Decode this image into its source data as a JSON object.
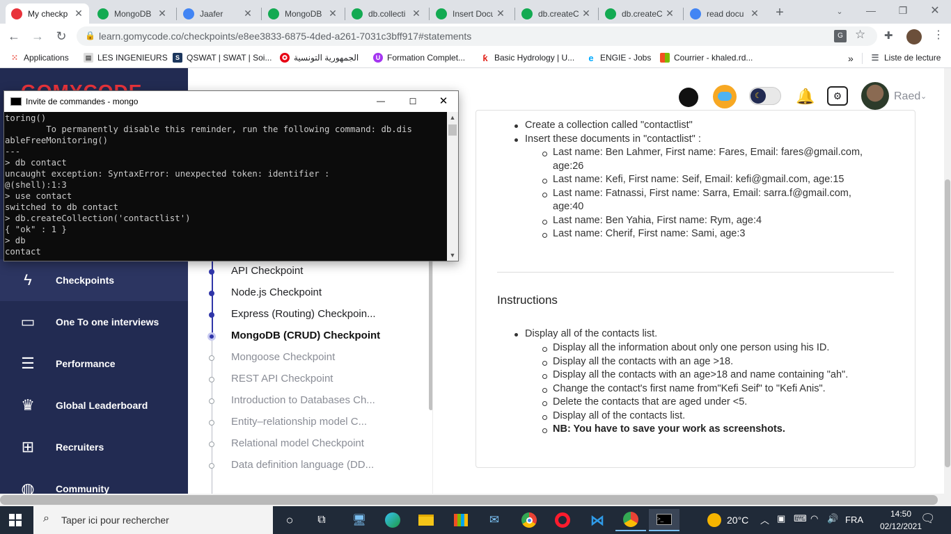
{
  "browser": {
    "tabs": [
      {
        "title": "My checkp",
        "active": true,
        "icon": "gomycode-icon",
        "color": "#e8333b"
      },
      {
        "title": "MongoDB",
        "icon": "mongodb-leaf-icon",
        "color": "#13aa52"
      },
      {
        "title": "Jaafer",
        "icon": "google-meet-icon",
        "color": "#4285f4"
      },
      {
        "title": "MongoDB",
        "icon": "mongodb-leaf-icon",
        "color": "#13aa52"
      },
      {
        "title": "db.collecti",
        "icon": "mongodb-leaf-icon",
        "color": "#13aa52"
      },
      {
        "title": "Insert Docu",
        "icon": "mongodb-leaf-icon",
        "color": "#13aa52"
      },
      {
        "title": "db.createC",
        "icon": "mongodb-leaf-icon",
        "color": "#13aa52"
      },
      {
        "title": "db.createC",
        "icon": "mongodb-leaf-icon",
        "color": "#13aa52"
      },
      {
        "title": "read docu",
        "icon": "google-icon",
        "color": "#4285f4"
      }
    ],
    "url": "learn.gomycode.co/checkpoints/e8ee3833-6875-4ded-a261-7031c3bff917#statements",
    "bookmarks": [
      {
        "label": "Applications"
      },
      {
        "label": "LES INGENIEURS"
      },
      {
        "label": "QSWAT | SWAT | Soi..."
      },
      {
        "label": "الجمهورية التونسية"
      },
      {
        "label": "Formation Complet..."
      },
      {
        "label": "Basic Hydrology | U..."
      },
      {
        "label": "ENGIE - Jobs"
      },
      {
        "label": "Courrier - khaled.rd..."
      }
    ],
    "reading_list": "Liste de lecture"
  },
  "header": {
    "user_name": "Raed"
  },
  "sidebar": {
    "items": [
      {
        "label": "Checkpoints",
        "icon": "lightning-icon",
        "active": true
      },
      {
        "label": "One To one interviews",
        "icon": "chat-icon"
      },
      {
        "label": "Performance",
        "icon": "document-lines-icon"
      },
      {
        "label": "Global Leaderboard",
        "icon": "trophy-icon"
      },
      {
        "label": "Recruiters",
        "icon": "org-chart-icon"
      },
      {
        "label": "Community",
        "icon": "globe-icon"
      }
    ]
  },
  "checkpoints": [
    {
      "label": "API Checkpoint",
      "state": "done"
    },
    {
      "label": "Node.js Checkpoint",
      "state": "done"
    },
    {
      "label": "Express (Routing) Checkpoin...",
      "state": "done"
    },
    {
      "label": "MongoDB (CRUD) Checkpoint",
      "state": "current"
    },
    {
      "label": "Mongoose Checkpoint",
      "state": "todo"
    },
    {
      "label": "REST API Checkpoint",
      "state": "todo"
    },
    {
      "label": "Introduction to Databases Ch...",
      "state": "todo"
    },
    {
      "label": "Entity–relationship model C...",
      "state": "todo"
    },
    {
      "label": "Relational model Checkpoint",
      "state": "todo"
    },
    {
      "label": "Data definition language (DD...",
      "state": "todo"
    }
  ],
  "statements": {
    "items": [
      "Create a collection called \"contactlist\"",
      "Insert these documents  in \"contactlist\" :"
    ],
    "documents": [
      {
        "line1": "Last name: Ben Lahmer, First name: Fares, Email: fares@gmail.com,",
        "line2": "age:26"
      },
      {
        "line1": "Last name: Kefi, First name: Seif, Email: kefi@gmail.com, age:15",
        "line2": ""
      },
      {
        "line1": "Last name: Fatnassi, First name: Sarra, Email: sarra.f@gmail.com,",
        "line2": "age:40"
      },
      {
        "line1": "Last name: Ben Yahia, First name: Rym, age:4",
        "line2": ""
      },
      {
        "line1": "Last name: Cherif, First name: Sami, age:3",
        "line2": ""
      }
    ]
  },
  "instructions": {
    "title": "Instructions",
    "main": "Display all of the contacts list.",
    "steps": [
      "Display all the information about only one person using his ID.",
      "Display all the contacts with an age >18.",
      "Display all the contacts with an age>18 and name containing \"ah\".",
      "Change the contact's first name from\"Kefi Seif\" to \"Kefi Anis\".",
      "Delete the contacts that are aged under <5.",
      "Display all of the contacts list."
    ],
    "note": "NB: You have to save your work as screenshots."
  },
  "cmd": {
    "title": "Invite de commandes - mongo",
    "lines": [
      "toring()",
      "        To permanently disable this reminder, run the following command: db.dis",
      "ableFreeMonitoring()",
      "---",
      "> db contact",
      "uncaught exception: SyntaxError: unexpected token: identifier :",
      "@(shell):1:3",
      "> use contact",
      "switched to db contact",
      "> db.createCollection('contactlist')",
      "{ \"ok\" : 1 }",
      "> db",
      "contact"
    ]
  },
  "taskbar": {
    "search_placeholder": "Taper ici pour rechercher",
    "weather": "20°C",
    "language": "FRA",
    "time": "14:50",
    "date": "02/12/2021"
  }
}
